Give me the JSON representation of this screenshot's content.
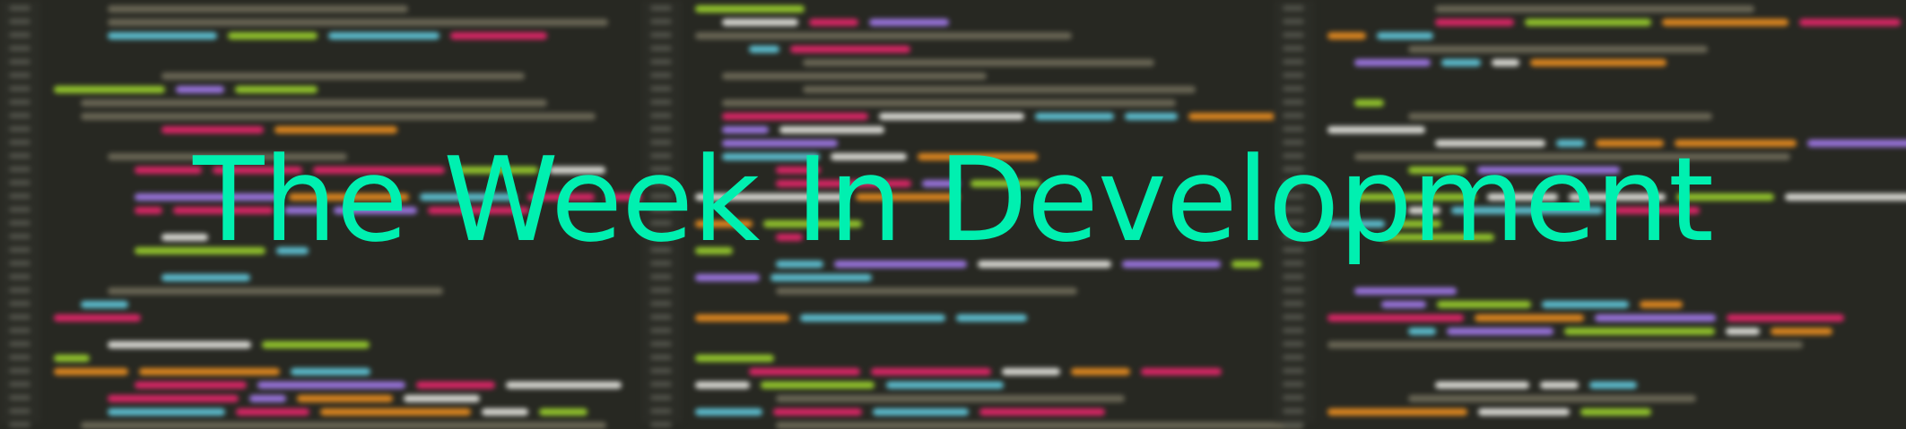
{
  "banner": {
    "title": "The Week In Development",
    "background": "blurred-code-editor",
    "colors": {
      "background": "#272822",
      "title": "#00f0b0",
      "code_palette": [
        "#75715e",
        "#66d9ef",
        "#a6e22e",
        "#f92672",
        "#fd971f",
        "#f8f8f2",
        "#ae81ff"
      ]
    }
  }
}
